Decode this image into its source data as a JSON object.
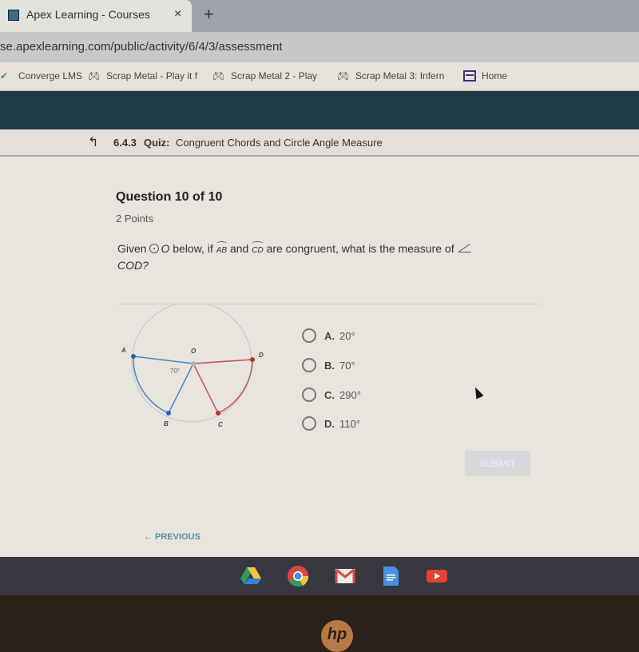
{
  "browser": {
    "tab_title": "Apex Learning - Courses",
    "tab_close_icon": "×",
    "new_tab_icon": "+",
    "url": "se.apexlearning.com/public/activity/6/4/3/assessment",
    "bookmarks": [
      {
        "label": "Converge LMS",
        "icon": "converge-icon"
      },
      {
        "label": "Scrap Metal - Play it f",
        "icon": "gamepad-icon"
      },
      {
        "label": "Scrap Metal 2 - Play",
        "icon": "gamepad-icon"
      },
      {
        "label": "Scrap Metal 3: Infern",
        "icon": "gamepad-icon"
      },
      {
        "label": "Home",
        "icon": "home-icon"
      }
    ]
  },
  "quiz": {
    "back_icon": "↰",
    "number": "6.4.3",
    "kind": "Quiz:",
    "name": "Congruent Chords and Circle Angle Measure"
  },
  "question": {
    "heading": "Question 10 of 10",
    "points": "2 Points",
    "prompt_given": "Given",
    "prompt_circle": "O",
    "prompt_below": "below, if",
    "arc1": "AB",
    "prompt_and": "and",
    "arc2": "CD",
    "prompt_rest": "are congruent, what is the measure of",
    "prompt_angle": "COD?",
    "diagram": {
      "labels": {
        "A": "A",
        "B": "B",
        "C": "C",
        "D": "D",
        "O": "O"
      },
      "angle_label": "70°",
      "colors": {
        "ab": "#4a86c8",
        "cd": "#c95050",
        "circle": "#c5c8d4"
      }
    },
    "options": [
      {
        "letter": "A.",
        "value": "20°"
      },
      {
        "letter": "B.",
        "value": "70°"
      },
      {
        "letter": "C.",
        "value": "290°"
      },
      {
        "letter": "D.",
        "value": "110°"
      }
    ],
    "submit_label": "SUBMIT",
    "previous_label": "← PREVIOUS"
  },
  "shelf": {
    "apps": [
      "Google Drive",
      "Chrome",
      "Gmail",
      "Docs",
      "YouTube"
    ]
  },
  "device_logo": "hp"
}
